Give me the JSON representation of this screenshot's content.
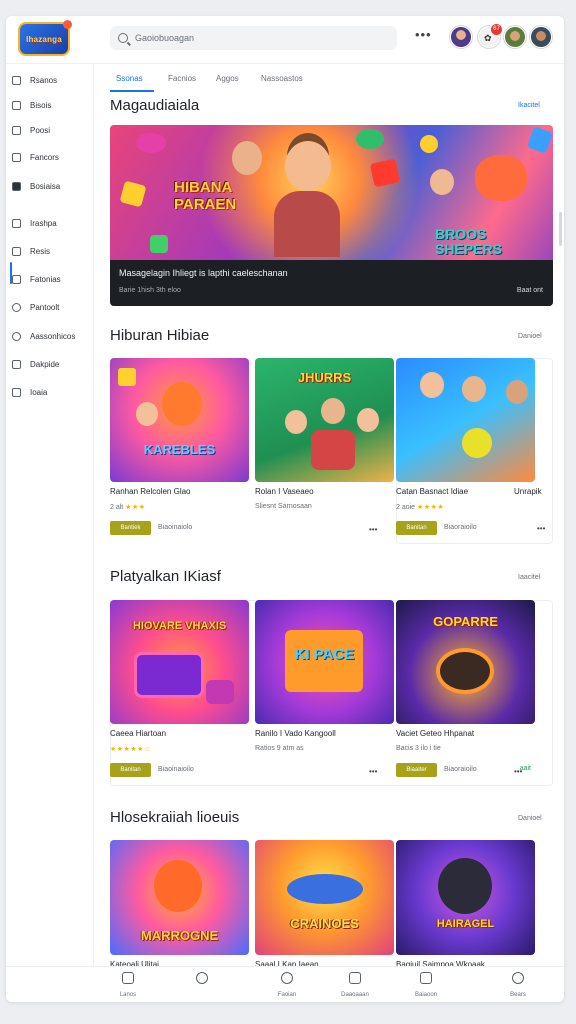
{
  "header": {
    "logo_text": "Ihazanga",
    "search_placeholder": "Gaoiobuoagan",
    "more_label": "•••",
    "notification_count": "67",
    "notification_glyph": "✿"
  },
  "sidebar": {
    "items": [
      {
        "label": "Rsanos",
        "icon": "home-icon"
      },
      {
        "label": "Bisois",
        "icon": "library-icon"
      },
      {
        "label": "Poosi",
        "icon": "list-icon"
      },
      {
        "label": "Fancors",
        "icon": "category-icon"
      },
      {
        "label": "Bosiaisa",
        "icon": "folder-icon"
      },
      {
        "label": "Irashpa",
        "icon": "bookmark-icon"
      },
      {
        "label": "Resis",
        "icon": "history-icon"
      },
      {
        "label": "Fatonias",
        "icon": "favorites-icon"
      },
      {
        "label": "Pantoolt",
        "icon": "clock-icon"
      },
      {
        "label": "Aassonhicos",
        "icon": "settings-icon"
      },
      {
        "label": "Dakpide",
        "icon": "tag-icon"
      },
      {
        "label": "Ioaia",
        "icon": "help-icon"
      }
    ]
  },
  "tabs": [
    {
      "label": "Ssonas"
    },
    {
      "label": "Facnios"
    },
    {
      "label": "Aggos"
    },
    {
      "label": "Nassoastos"
    }
  ],
  "featured": {
    "title": "Magaudiaiala",
    "link": "Ikacitel",
    "banner_left": "HIBANA PARAEN",
    "banner_right": "BROOS SHEPERS",
    "caption_title": "Masagelagin Ihliegt is lapthi caeleschanan",
    "caption_sub": "Barie 1hish 3th eloo",
    "caption_right": "Baat ont"
  },
  "sections": [
    {
      "title": "Hiburan Hibiae",
      "link": "Danioel",
      "cards": [
        {
          "art": "KAREBLES",
          "name": "Ranhan Relcolen Glao",
          "meta": "2 alt",
          "stars": "★★★",
          "pill": "Bantiek",
          "pill_text": "Biaoinaiolo",
          "right": ""
        },
        {
          "art": "JHURRS",
          "name": "Rolan I Vaseaeo",
          "meta": "Sliesnt Sarnosaan",
          "stars": "",
          "pill": "",
          "pill_text": "",
          "right": ""
        },
        {
          "art": "",
          "name": "Catan Basnact Idiae",
          "meta": "2 aoie",
          "stars": "★★★★",
          "pill": "Banitan",
          "pill_text": "Biaoraioilo",
          "right": "Unrapik"
        }
      ]
    },
    {
      "title": "Platyalkan IKiasf",
      "link": "Iaacitel",
      "cards": [
        {
          "art": "HIOVARE VHAXIS",
          "name": "Caeea Hiartoan",
          "meta": "",
          "stars": "★★★★★☆",
          "pill": "Banitan",
          "pill_text": "Biaoinaioilo",
          "right": ""
        },
        {
          "art": "KI PACE",
          "name": "Ranilo I Vado Kangooll",
          "meta": "Ratios 9 atm as",
          "stars": "",
          "pill": "",
          "pill_text": "",
          "right": ""
        },
        {
          "art": "GOPARRE",
          "name": "Vaciet Geteo Hhpanat",
          "meta": "Bacis 3 ilo i tie",
          "stars": "",
          "pill": "Biaaiter",
          "pill_text": "Biaoraioilo",
          "right": "aait"
        }
      ]
    },
    {
      "title": "Hlosekraiiah lioeuis",
      "link": "Danioel",
      "cards": [
        {
          "art": "MARROGNE",
          "name": "Kateoali Ulitai",
          "meta": "",
          "stars": "",
          "pill": "",
          "pill_text": "",
          "right": ""
        },
        {
          "art": "CRAINOES",
          "name": "Saaal I Kan Iaean",
          "meta": "",
          "stars": "",
          "pill": "",
          "pill_text": "",
          "right": ""
        },
        {
          "art": "HAIRAGEL",
          "name": "Bagiuil Saimpoa Wkoaak",
          "meta": "",
          "stars": "",
          "pill": "",
          "pill_text": "",
          "right": ""
        }
      ]
    }
  ],
  "bottom_nav": [
    {
      "label": "Lanos",
      "icon": "home-icon"
    },
    {
      "label": "",
      "icon": "search-icon"
    },
    {
      "label": "Faoian",
      "icon": "compass-icon"
    },
    {
      "label": "Daaoaaan",
      "icon": "chart-icon"
    },
    {
      "label": "Baiaoon",
      "icon": "library-icon"
    },
    {
      "label": "Bears",
      "icon": "profile-icon"
    }
  ],
  "colors": {
    "accent": "#1a73e8",
    "pill": "#a6a21a",
    "star": "#f4b400"
  }
}
